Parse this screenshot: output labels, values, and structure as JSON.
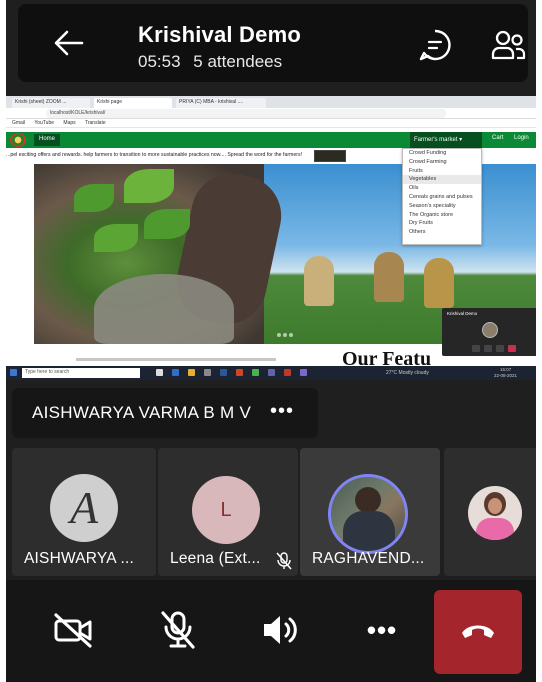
{
  "header": {
    "meeting_title": "Krishival Demo",
    "duration": "05:53",
    "attendees": "5 attendees"
  },
  "shared_screen": {
    "browser_tabs": [
      "Krishi (sheet) ZOOM ...",
      "Krishi page",
      "PRIYA (C) MBA - krishival ...."
    ],
    "address": "localhost/KOLE/krishival/",
    "bookmarks": [
      "Gmail",
      "YouTube",
      "Maps",
      "Translate"
    ],
    "site_home": "Home",
    "site_market": "Farmer's market ▾",
    "site_cart": "Cart",
    "site_login": "Login",
    "marquee_text": "...pel exciting offers and rewards. help farmers to transition to more sustainable practices now.... Spread the word for the farmers!",
    "market_menu": [
      "Crowd Funding",
      "Crowd Farming",
      "Fruits",
      "Vegetables",
      "Oils",
      "Cereals grains and pulses",
      "Season's speciality",
      "The Organic store",
      "Dry Fruits",
      "Others"
    ],
    "highlighted_menu_index": 3,
    "section_heading": "Our Featu",
    "mini_window_title": "Krishival Demo",
    "taskbar_search": "Type here to search",
    "taskbar_weather": "27°C Mostly cloudy",
    "taskbar_time": "16:07",
    "taskbar_date": "22-08-2021"
  },
  "presenter": {
    "name": "AISHWARYA VARMA B M V",
    "more": "•••"
  },
  "participants": [
    {
      "name": "AISHWARYA ...",
      "avatar": "A",
      "muted": false
    },
    {
      "name": "Leena (Ext...",
      "avatar": "L",
      "muted": true
    },
    {
      "name": "RAGHAVEND...",
      "avatar": "",
      "muted": false
    },
    {
      "name": "",
      "avatar": "",
      "muted": false
    }
  ],
  "controls": {
    "more": "•••"
  },
  "colors": {
    "end_call": "#a4262c",
    "site_green": "#0a8a34",
    "leena_avatar": "#d9b8bc",
    "leena_letter": "#8a2f2f"
  }
}
